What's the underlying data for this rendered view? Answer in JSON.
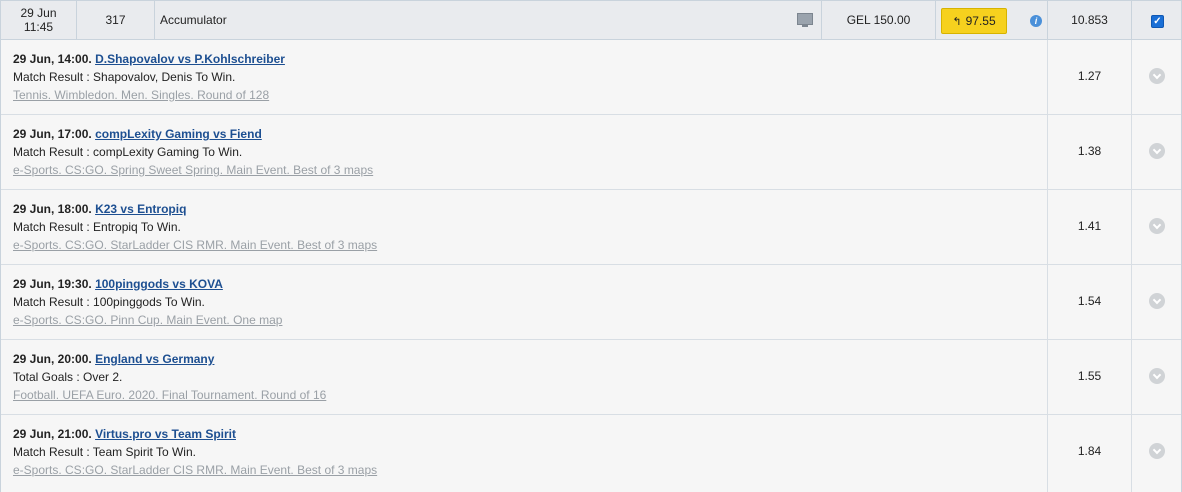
{
  "bet": {
    "date": "29 Jun",
    "time": "11:45",
    "id": "317",
    "type": "Accumulator",
    "stake": "GEL 150.00",
    "cashout": "97.55",
    "odds": "10.853"
  },
  "legs": [
    {
      "datetime": "29 Jun, 14:00.",
      "match": "D.Shapovalov vs P.Kohlschreiber",
      "market": "Match Result : Shapovalov, Denis To Win.",
      "competition": "Tennis. Wimbledon. Men. Singles. Round of 128",
      "odds": "1.27"
    },
    {
      "datetime": "29 Jun, 17:00.",
      "match": "compLexity Gaming vs Fiend",
      "market": "Match Result : compLexity Gaming To Win.",
      "competition": "e-Sports. CS:GO. Spring Sweet Spring. Main Event. Best of 3 maps",
      "odds": "1.38"
    },
    {
      "datetime": "29 Jun, 18:00.",
      "match": "K23 vs Entropiq",
      "market": "Match Result : Entropiq To Win.",
      "competition": "e-Sports. CS:GO. StarLadder CIS RMR. Main Event. Best of 3 maps",
      "odds": "1.41"
    },
    {
      "datetime": "29 Jun, 19:30.",
      "match": "100pinggods vs KOVA",
      "market": "Match Result : 100pinggods To Win.",
      "competition": "e-Sports. CS:GO. Pinn Cup. Main Event. One map",
      "odds": "1.54"
    },
    {
      "datetime": "29 Jun, 20:00.",
      "match": "England vs Germany",
      "market": "Total Goals : Over 2.",
      "competition": "Football. UEFA Euro. 2020. Final Tournament. Round of 16",
      "odds": "1.55"
    },
    {
      "datetime": "29 Jun, 21:00.",
      "match": "Virtus.pro vs Team Spirit",
      "market": "Match Result : Team Spirit To Win.",
      "competition": "e-Sports. CS:GO. StarLadder CIS RMR. Main Event. Best of 3 maps",
      "odds": "1.84"
    }
  ],
  "icons": {
    "monitor": "monitor-icon",
    "info": "info-icon",
    "cashout_arrow": "cashout-arrow-icon",
    "expand": "chevron-down-icon"
  },
  "colors": {
    "cashout_bg": "#f6d11e",
    "link": "#1d4f91",
    "checkbox": "#1a6fd6"
  }
}
